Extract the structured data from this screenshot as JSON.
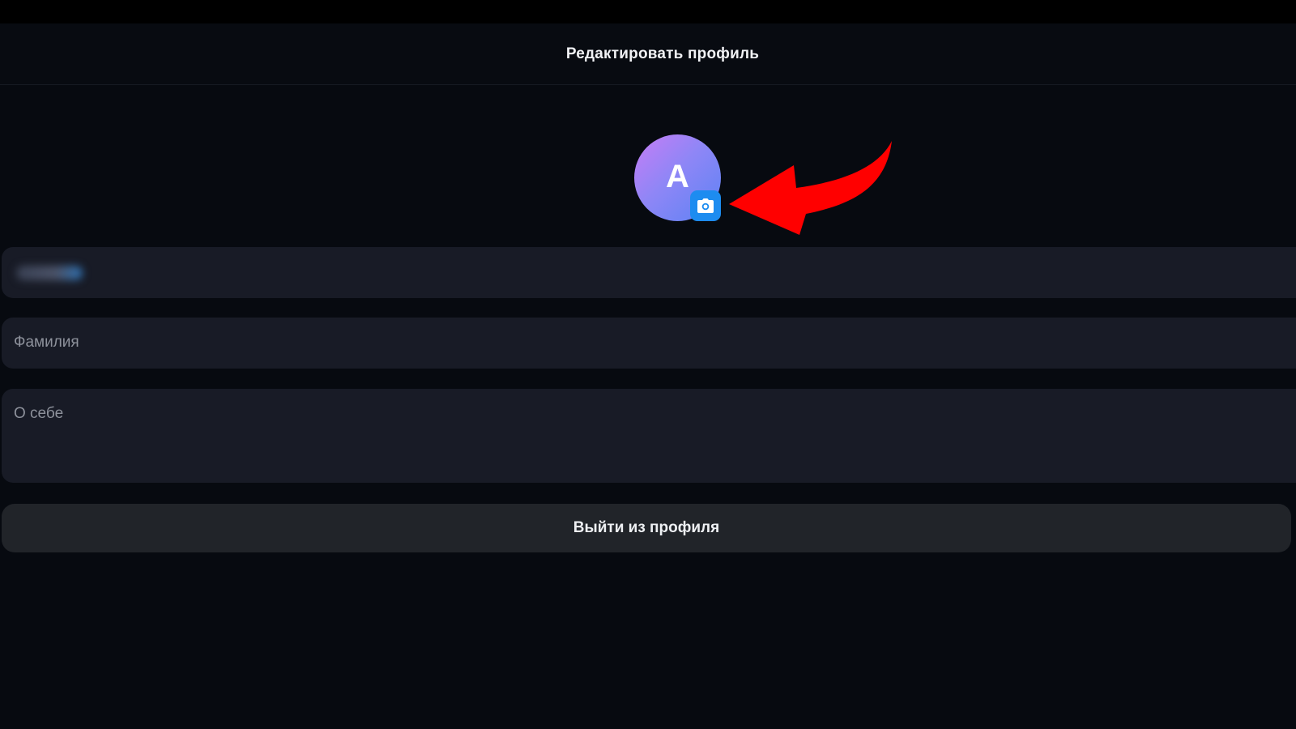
{
  "header": {
    "title": "Редактировать профиль"
  },
  "avatar": {
    "initial": "A",
    "gradient_start": "#c77df5",
    "gradient_end": "#5c83f4",
    "camera_icon": "camera-icon",
    "camera_button_color": "#1d8cf0"
  },
  "annotation": {
    "arrow_color": "#ff0000"
  },
  "form": {
    "last_name_placeholder": "Фамилия",
    "bio_placeholder": "О себе"
  },
  "actions": {
    "logout_label": "Выйти из профиля"
  }
}
